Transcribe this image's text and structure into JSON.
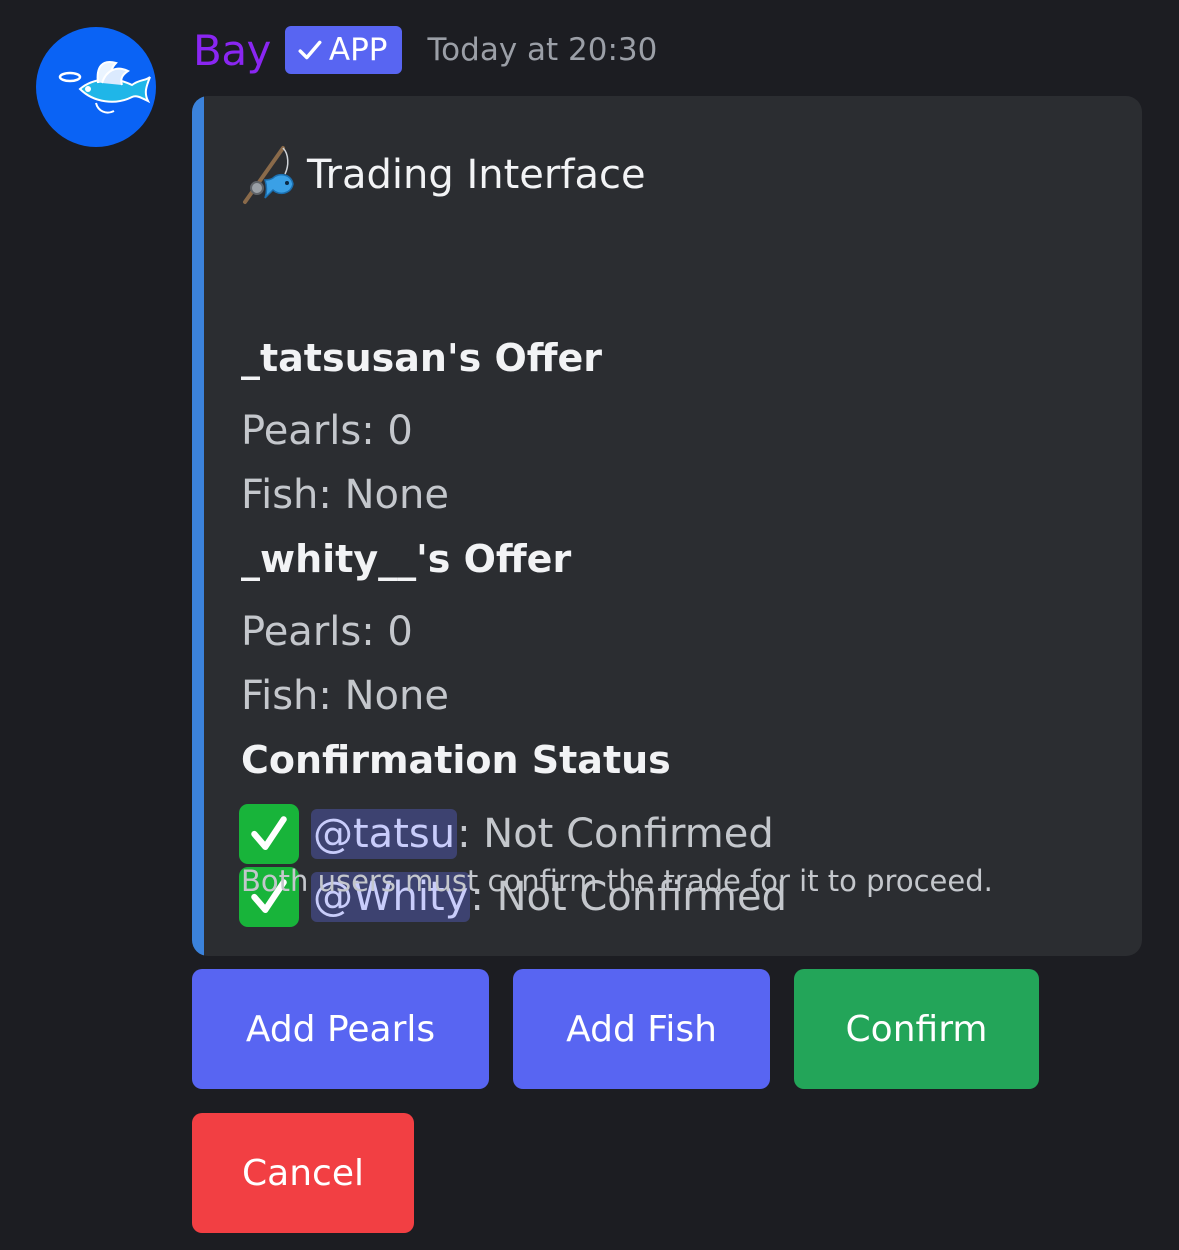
{
  "author": {
    "username": "Bay",
    "badge": "APP",
    "timestamp": "Today at 20:30",
    "avatar_icon": "flying-fish-icon"
  },
  "embed": {
    "accent_color": "#3b82db",
    "title": "Trading Interface",
    "title_icon": "fishing-pole-icon",
    "offers": [
      {
        "heading": "_tatsusan's Offer",
        "pearls": "Pearls: 0",
        "fish": "Fish: None"
      },
      {
        "heading": "_whity__'s Offer",
        "pearls": "Pearls: 0",
        "fish": "Fish: None"
      }
    ],
    "status_heading": "Confirmation Status",
    "statuses": [
      {
        "mention": "@tatsu",
        "text": ": Not Confirmed"
      },
      {
        "mention": "@Whity",
        "text": ": Not Confirmed"
      }
    ],
    "footer": "Both users must confirm the trade for it to proceed."
  },
  "buttons": {
    "add_pearls": "Add Pearls",
    "add_fish": "Add Fish",
    "confirm": "Confirm",
    "cancel": "Cancel"
  },
  "colors": {
    "username": "#8a26f2",
    "blurple": "#5865f2",
    "success": "#23a559",
    "danger": "#f23f43"
  }
}
